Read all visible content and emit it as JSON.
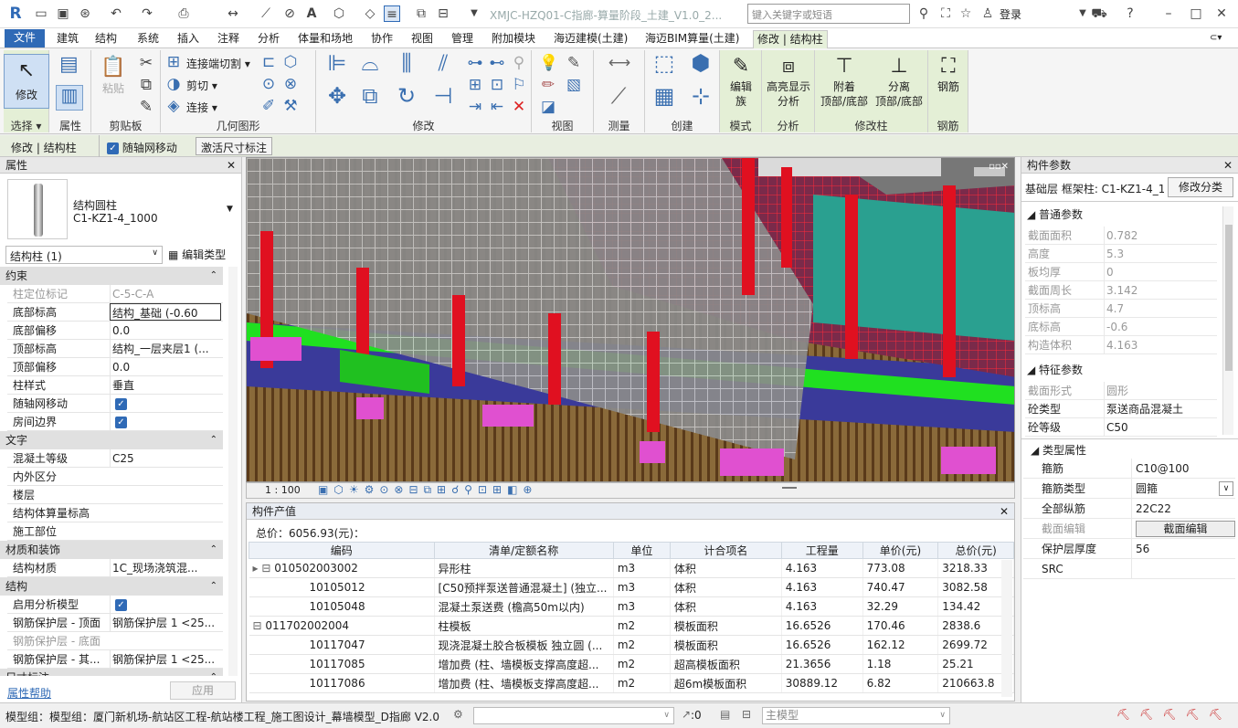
{
  "app": {
    "logo": "R",
    "doc_title": "XMJC-HZQ01-C指廊-算量阶段_土建_V1.0_2...",
    "search_placeholder": "键入关键字或短语",
    "login": "登录"
  },
  "tabs": [
    "文件",
    "建筑",
    "结构",
    "系统",
    "插入",
    "注释",
    "分析",
    "体量和场地",
    "协作",
    "视图",
    "管理",
    "附加模块",
    "海迈建模(土建)",
    "海迈BIM算量(土建)",
    "修改 | 结构柱"
  ],
  "ribbon": {
    "modify_label": "修改",
    "select_label": "选择",
    "properties_label": "属性",
    "clipboard_label": "剪贴板",
    "paste_label": "粘贴",
    "geometry_label": "几何图形",
    "join_cut": "连接端切割",
    "cut": "剪切",
    "join": "连接",
    "modify_group": "修改",
    "view_group": "视图",
    "measure_group": "测量",
    "create_group": "创建",
    "edit_family": "编辑\n族",
    "mode_group": "模式",
    "highlight": "高亮显示\n分析",
    "analysis_group": "分析",
    "attach": "附着\n顶部/底部",
    "detach": "分离\n顶部/底部",
    "modify_column_group": "修改柱",
    "rebar": "钢筋",
    "rebar_group": "钢筋"
  },
  "optbar": {
    "context": "修改 | 结构柱",
    "move_with_grid": "随轴网移动",
    "activate_dim": "激活尺寸标注"
  },
  "props": {
    "title": "属性",
    "type_name": "结构圆柱",
    "type_sub": "C1-KZ1-4_1000",
    "selector": "结构柱 (1)",
    "edit_type": "编辑类型",
    "sections": [
      {
        "name": "约束",
        "rows": [
          [
            "柱定位标记",
            "C-5-C-A",
            true
          ],
          [
            "底部标高",
            "结构_基础  (-0.60",
            false
          ],
          [
            "底部偏移",
            "0.0",
            false
          ],
          [
            "顶部标高",
            "结构_一层夹层1 (...",
            false
          ],
          [
            "顶部偏移",
            "0.0",
            false
          ],
          [
            "柱样式",
            "垂直",
            false
          ],
          [
            "随轴网移动",
            "✓",
            false
          ],
          [
            "房间边界",
            "✓",
            false
          ]
        ]
      },
      {
        "name": "文字",
        "rows": [
          [
            "混凝土等级",
            "C25",
            false
          ],
          [
            "内外区分",
            "",
            false
          ],
          [
            "楼层",
            "",
            false
          ],
          [
            "结构体算量标高",
            "",
            false
          ],
          [
            "施工部位",
            "",
            false
          ]
        ]
      },
      {
        "name": "材质和装饰",
        "rows": [
          [
            "结构材质",
            "1C_现场浇筑混...",
            false
          ]
        ]
      },
      {
        "name": "结构",
        "rows": [
          [
            "启用分析模型",
            "✓",
            false
          ],
          [
            "钢筋保护层 - 顶面",
            "钢筋保护层 1 <25...",
            false
          ],
          [
            "钢筋保护层 - 底面",
            "",
            true
          ],
          [
            "钢筋保护层 - 其...",
            "钢筋保护层 1 <25...",
            false
          ]
        ]
      }
    ],
    "last_section": "尺寸标注",
    "help": "属性帮助",
    "apply": "应用"
  },
  "viewbar": {
    "scale": "1 : 100"
  },
  "cost": {
    "title": "构件产值",
    "total": "总价：6056.93(元)：",
    "headers": [
      "编码",
      "清单/定额名称",
      "单位",
      "计合项名",
      "工程量",
      "单价(元)",
      "总价(元)"
    ],
    "rows": [
      {
        "level": 0,
        "code": "010502003002",
        "name": "异形柱",
        "unit": "m3",
        "item": "体积",
        "qty": "4.163",
        "price": "773.08",
        "total": "3218.33"
      },
      {
        "level": 1,
        "code": "10105012",
        "name": "[C50预拌泵送普通混凝土] (独立...",
        "unit": "m3",
        "item": "体积",
        "qty": "4.163",
        "price": "740.47",
        "total": "3082.58"
      },
      {
        "level": 1,
        "code": "10105048",
        "name": "混凝土泵送费 (檐高50m以内)",
        "unit": "m3",
        "item": "体积",
        "qty": "4.163",
        "price": "32.29",
        "total": "134.42"
      },
      {
        "level": 0,
        "code": "011702002004",
        "name": "柱模板",
        "unit": "m2",
        "item": "模板面积",
        "qty": "16.6526",
        "price": "170.46",
        "total": "2838.6"
      },
      {
        "level": 1,
        "code": "10117047",
        "name": "现浇混凝土胶合板模板 独立圆 (...",
        "unit": "m2",
        "item": "模板面积",
        "qty": "16.6526",
        "price": "162.12",
        "total": "2699.72"
      },
      {
        "level": 1,
        "code": "10117085",
        "name": "增加费 (柱、墙模板支撑高度超...",
        "unit": "m2",
        "item": "超高模板面积",
        "qty": "21.3656",
        "price": "1.18",
        "total": "25.21"
      },
      {
        "level": 1,
        "code": "10117086",
        "name": "增加费 (柱、墙模板支撑高度超...",
        "unit": "m2",
        "item": "超6m模板面积",
        "qty": "30889.12",
        "price": "6.82",
        "total": "210663.8"
      }
    ]
  },
  "cparams": {
    "title": "构件参数",
    "header": "基础层 框架柱: C1-KZ1-4_1(",
    "modify_class": "修改分类",
    "general": "普通参数",
    "general_rows": [
      [
        "截面面积",
        "0.782"
      ],
      [
        "高度",
        "5.3"
      ],
      [
        "板均厚",
        "0"
      ],
      [
        "截面周长",
        "3.142"
      ],
      [
        "顶标高",
        "4.7"
      ],
      [
        "底标高",
        "-0.6"
      ],
      [
        "构造体积",
        "4.163"
      ]
    ],
    "feature": "特征参数",
    "feature_rows": [
      [
        "截面形式",
        "圆形",
        true
      ],
      [
        "砼类型",
        "泵送商品混凝土",
        false
      ],
      [
        "砼等级",
        "C50",
        false
      ]
    ],
    "type_attr": "类型属性",
    "type_rows": [
      [
        "箍筋",
        "C10@100"
      ],
      [
        "箍筋类型",
        "圆箍"
      ],
      [
        "全部纵筋",
        "22C22"
      ],
      [
        "截面编辑",
        "截面编辑"
      ],
      [
        "保护层厚度",
        "56"
      ],
      [
        "SRC",
        ""
      ]
    ]
  },
  "status": {
    "text": "模型组：模型组：厦门新机场-航站区工程-航站楼工程_施工图设计_幕墙模型_D指廊 V2.0",
    "zero": ":0",
    "main_model": "主模型"
  },
  "colors": {
    "accent": "#2f6ab6",
    "ribbon_ctx": "#e4efd6"
  }
}
